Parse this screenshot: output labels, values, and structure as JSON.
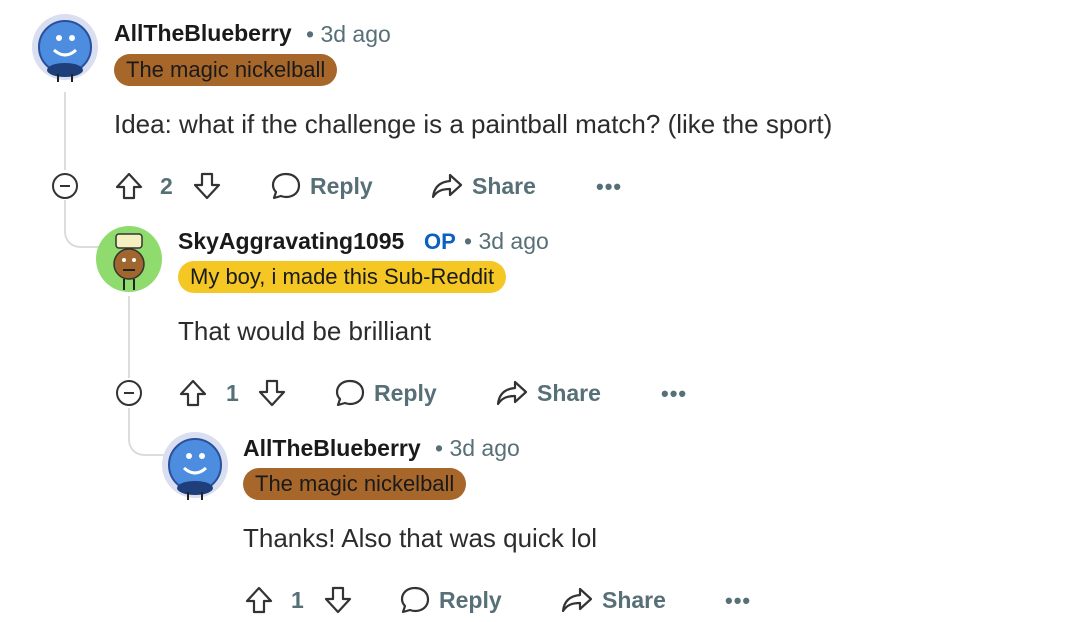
{
  "comments": [
    {
      "username": "AllTheBlueberry",
      "time": "3d ago",
      "flair": "The magic nickelball",
      "body": "Idea: what if the challenge is a paintball match? (like the sport)",
      "votes": "2",
      "reply_label": "Reply",
      "share_label": "Share",
      "more_label": "•••"
    },
    {
      "username": "SkyAggravating1095",
      "op_badge": "OP",
      "time": "3d ago",
      "flair": "My boy, i made this Sub-Reddit",
      "body": "That would be brilliant",
      "votes": "1",
      "reply_label": "Reply",
      "share_label": "Share",
      "more_label": "•••"
    },
    {
      "username": "AllTheBlueberry",
      "time": "3d ago",
      "flair": "The magic nickelball",
      "body": "Thanks! Also that was quick lol",
      "votes": "1",
      "reply_label": "Reply",
      "share_label": "Share",
      "more_label": "•••"
    }
  ],
  "colors": {
    "flair_brown": "#a8672a",
    "flair_yellow": "#f4c724",
    "op_blue": "#0a5fc1",
    "meta_gray": "#576f76"
  }
}
